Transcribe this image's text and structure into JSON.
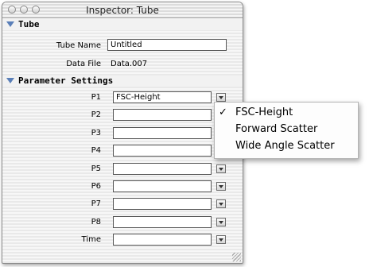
{
  "window": {
    "title": "Inspector: Tube"
  },
  "tube_section": {
    "label": "Tube",
    "tube_name_label": "Tube Name",
    "tube_name_value": "Untitled",
    "data_file_label": "Data File",
    "data_file_value": "Data.007"
  },
  "parameter_section": {
    "label": "Parameter Settings",
    "rows": [
      {
        "label": "P1",
        "value": "FSC-Height"
      },
      {
        "label": "P2",
        "value": ""
      },
      {
        "label": "P3",
        "value": ""
      },
      {
        "label": "P4",
        "value": ""
      },
      {
        "label": "P5",
        "value": ""
      },
      {
        "label": "P6",
        "value": ""
      },
      {
        "label": "P7",
        "value": ""
      },
      {
        "label": "P8",
        "value": ""
      },
      {
        "label": "Time",
        "value": ""
      }
    ]
  },
  "popup_menu": {
    "items": [
      {
        "label": "FSC-Height",
        "checked": true,
        "check_mark": "✓"
      },
      {
        "label": "Forward Scatter",
        "checked": false,
        "check_mark": ""
      },
      {
        "label": "Wide Angle Scatter",
        "checked": false,
        "check_mark": ""
      }
    ]
  },
  "colors": {
    "disclosure_triangle": "#5a7fb8",
    "window_border": "#8c8c8c"
  }
}
